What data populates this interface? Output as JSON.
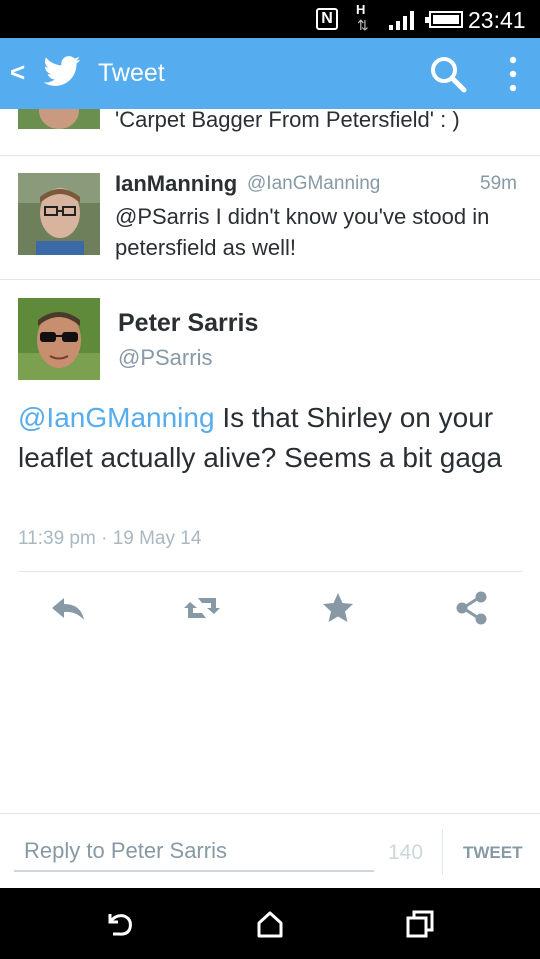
{
  "status_bar": {
    "nfc_label": "N",
    "network_label": "H",
    "time": "23:41"
  },
  "app_bar": {
    "title": "Tweet",
    "color": "#55acee"
  },
  "timeline": [
    {
      "text": "'Carpet Bagger From Petersfield' : )"
    },
    {
      "name": "IanManning",
      "handle": "@IanGManning",
      "time": "59m",
      "text": "@PSarris I didn't know you've stood in petersfield as well!"
    }
  ],
  "detail": {
    "name": "Peter Sarris",
    "handle": "@PSarris",
    "mention": "@IanGManning",
    "text": " Is that Shirley on your leaflet actually alive? Seems a bit gaga",
    "timestamp": "11:39 pm · 19 May 14"
  },
  "actions": {
    "reply_icon": "reply-icon",
    "retweet_icon": "retweet-icon",
    "favorite_icon": "star-icon",
    "share_icon": "share-icon"
  },
  "reply_bar": {
    "placeholder": "Reply to Peter Sarris",
    "char_count": "140",
    "tweet_button": "TWEET"
  }
}
